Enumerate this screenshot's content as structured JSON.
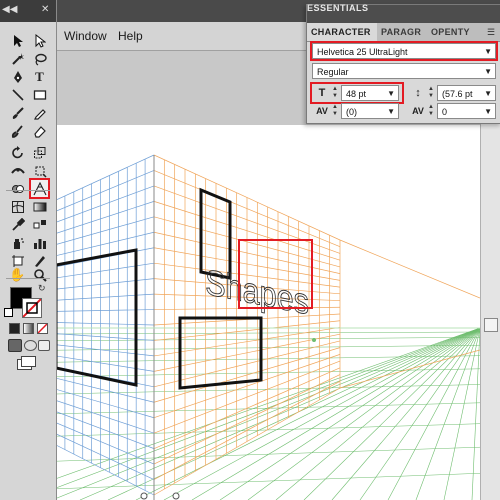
{
  "menubar": {
    "items": [
      "Window",
      "Help"
    ]
  },
  "panel": {
    "essentials_label": "ESSENTIALS",
    "tabs": [
      "CHARACTER",
      "PARAGR",
      "OPENTY"
    ],
    "font_family": "Helvetica 25 UltraLight",
    "font_style": "Regular",
    "font_size": "48 pt",
    "leading": "(57.6 pt",
    "kerning": "(0)",
    "tracking": "0",
    "highlight_color": "#e31b23"
  },
  "canvas": {
    "text_object": "Shapes",
    "grid_left_color": "#6f9fd6",
    "grid_right_color": "#f0a55a",
    "grid_floor_color": "#6ebd6e"
  },
  "tools": {
    "highlighted": "perspective-grid-tool",
    "icons": [
      "selection-tool-icon",
      "direct-selection-tool-icon",
      "magic-wand-icon",
      "lasso-icon",
      "pen-tool-icon",
      "type-tool-icon",
      "line-segment-icon",
      "rectangle-tool-icon",
      "paintbrush-icon",
      "pencil-icon",
      "blob-brush-icon",
      "eraser-icon",
      "rotate-icon",
      "scale-icon",
      "width-tool-icon",
      "free-transform-icon",
      "shape-builder-icon",
      "perspective-grid-icon",
      "mesh-icon",
      "gradient-icon",
      "eyedropper-icon",
      "blend-icon",
      "symbol-sprayer-icon",
      "column-graph-icon",
      "artboard-icon",
      "slice-icon",
      "hand-icon",
      "zoom-icon"
    ]
  }
}
